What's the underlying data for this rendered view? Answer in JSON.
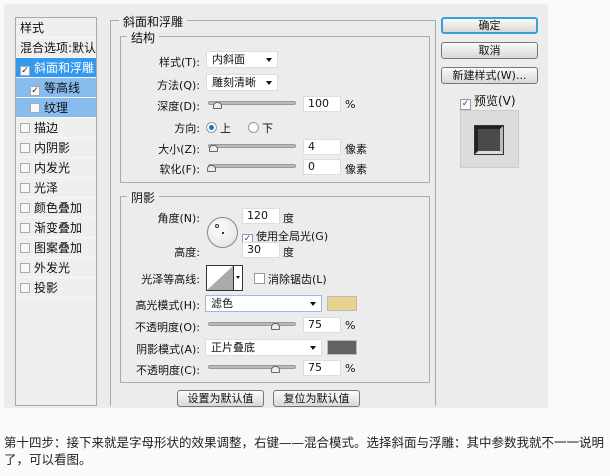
{
  "styles_list": {
    "header": "样式",
    "blend_options": "混合选项:默认",
    "items": [
      {
        "label": "斜面和浮雕",
        "checked": true,
        "state": "selected"
      },
      {
        "label": "等高线",
        "checked": true,
        "state": "sub"
      },
      {
        "label": "纹理",
        "checked": false,
        "state": "sub"
      },
      {
        "label": "描边",
        "checked": false
      },
      {
        "label": "内阴影",
        "checked": false
      },
      {
        "label": "内发光",
        "checked": false
      },
      {
        "label": "光泽",
        "checked": false
      },
      {
        "label": "颜色叠加",
        "checked": false
      },
      {
        "label": "渐变叠加",
        "checked": false
      },
      {
        "label": "图案叠加",
        "checked": false
      },
      {
        "label": "外发光",
        "checked": false
      },
      {
        "label": "投影",
        "checked": false
      }
    ]
  },
  "bevel": {
    "title": "斜面和浮雕",
    "structure": {
      "title": "结构",
      "style_label": "样式(T):",
      "style_value": "内斜面",
      "technique_label": "方法(Q):",
      "technique_value": "雕刻清晰",
      "depth_label": "深度(D):",
      "depth_value": "100",
      "depth_unit": "%",
      "direction_label": "方向:",
      "dir_up": "上",
      "dir_down": "下",
      "size_label": "大小(Z):",
      "size_value": "4",
      "size_unit": "像素",
      "soften_label": "软化(F):",
      "soften_value": "0",
      "soften_unit": "像素"
    },
    "shading": {
      "title": "阴影",
      "angle_label": "角度(N):",
      "angle_value": "120",
      "angle_unit": "度",
      "global_light": "使用全局光(G)",
      "altitude_label": "高度:",
      "altitude_value": "30",
      "altitude_unit": "度",
      "gloss_label": "光泽等高线:",
      "antialias": "消除锯齿(L)",
      "highlight_label": "高光模式(H):",
      "highlight_mode": "滤色",
      "highlight_color": "#e6d391",
      "hl_opacity_label": "不透明度(O):",
      "hl_opacity": "75",
      "hl_opacity_unit": "%",
      "shadow_label": "阴影模式(A):",
      "shadow_mode": "正片叠底",
      "shadow_color": "#626262",
      "sh_opacity_label": "不透明度(C):",
      "sh_opacity": "75",
      "sh_opacity_unit": "%"
    },
    "make_default": "设置为默认值",
    "reset_default": "复位为默认值"
  },
  "right": {
    "ok": "确定",
    "cancel": "取消",
    "new_style": "新建样式(W)...",
    "preview": "预览(V)"
  },
  "caption": "第十四步：接下来就是字母形状的效果调整，右键——混合模式。选择斜面与浮雕：其中参数我就不一一说明了，可以看图。"
}
